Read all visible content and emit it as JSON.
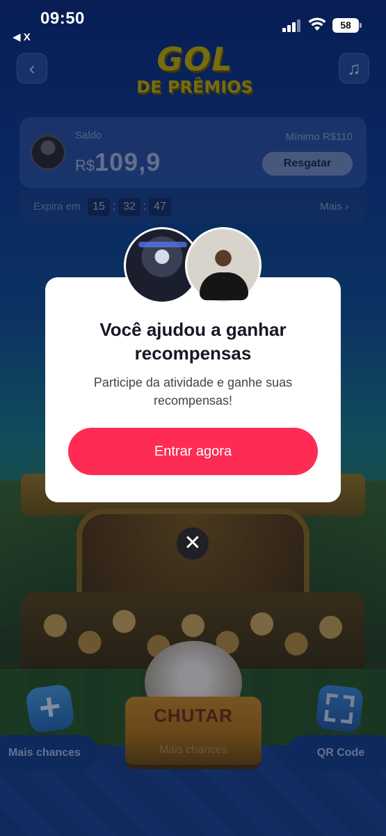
{
  "status_bar": {
    "time": "09:50",
    "back_app": "◀ X",
    "battery": "58",
    "signal_icon": "cellular-signal-icon",
    "wifi_icon": "wifi-icon"
  },
  "header": {
    "logo_line1": "GOL",
    "logo_line2": "DE PRÊMIOS",
    "back_icon": "chevron-left-icon",
    "music_icon": "music-note-icon"
  },
  "balance": {
    "label": "Saldo",
    "currency": "R$",
    "amount": "109,9",
    "minimum": "Mínimo  R$110",
    "redeem_button": "Resgatar",
    "expires_label": "Expira em",
    "timer": {
      "hours": "15",
      "minutes": "32",
      "seconds": "47"
    },
    "more_link": "Mais ›"
  },
  "bottom": {
    "left_button": "Mais chances",
    "center_button": "CHUTAR",
    "center_sub": "Mais chances",
    "right_button": "QR Code",
    "plus_icon": "plus-icon",
    "qr_icon": "qr-scan-icon"
  },
  "modal": {
    "title": "Você ajudou  a ganhar recompensas",
    "subtitle": "Participe da atividade e ganhe suas recompensas!",
    "cta": "Entrar agora",
    "close_icon": "close-icon",
    "close_glyph": "✕"
  },
  "colors": {
    "cta": "#fe2c55",
    "logo": "#c9b200",
    "background": "#0c2a78"
  }
}
